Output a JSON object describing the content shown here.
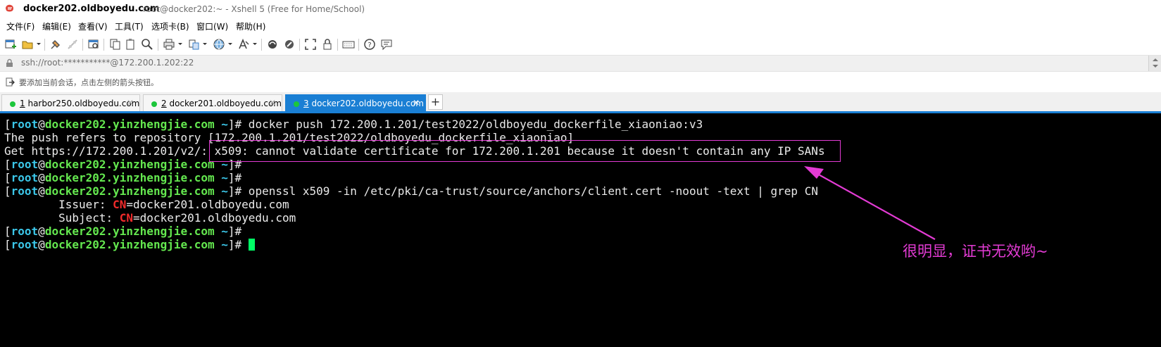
{
  "window": {
    "title_main": "docker202.oldboyedu.com",
    "title_sub": "root@docker202:~ - Xshell 5 (Free for Home/School)"
  },
  "menu": {
    "items": [
      "文件(F)",
      "编辑(E)",
      "查看(V)",
      "工具(T)",
      "选项卡(B)",
      "窗口(W)",
      "帮助(H)"
    ]
  },
  "toolbar": {
    "icons": [
      "new-session-icon",
      "open-folder-icon",
      "connect-icon",
      "disconnect-icon",
      "properties-icon",
      "copy-icon",
      "paste-icon",
      "find-icon",
      "print-icon",
      "transfer-icon",
      "globe-icon",
      "font-icon",
      "xftp-icon",
      "xmanager-icon",
      "fullscreen-icon",
      "lock-icon",
      "keyboard-icon",
      "help-icon",
      "chat-icon"
    ]
  },
  "address": {
    "text": "ssh://root:***********@172.200.1.202:22"
  },
  "hint": {
    "text": "要添加当前会话，点击左侧的箭头按钮。"
  },
  "tabs": [
    {
      "num": "1",
      "label": "harbor250.oldboyedu.com",
      "active": false
    },
    {
      "num": "2",
      "label": "docker201.oldboyedu.com",
      "active": false
    },
    {
      "num": "3",
      "label": "docker202.oldboyedu.com",
      "active": true
    }
  ],
  "terminal": {
    "prompt": {
      "open": "[",
      "user": "root",
      "at": "@",
      "host": "docker202.yinzhengjie.com",
      "path": " ~",
      "close": "]#"
    },
    "lines": [
      {
        "kind": "prompt",
        "cmd": " docker push 172.200.1.201/test2022/oldboyedu_dockerfile_xiaoniao:v3"
      },
      {
        "kind": "text",
        "text": "The push refers to repository [172.200.1.201/test2022/oldboyedu_dockerfile_xiaoniao]"
      },
      {
        "kind": "text",
        "text": "Get https://172.200.1.201/v2/: x509: cannot validate certificate for 172.200.1.201 because it doesn't contain any IP SANs"
      },
      {
        "kind": "prompt",
        "cmd": ""
      },
      {
        "kind": "prompt",
        "cmd": ""
      },
      {
        "kind": "prompt",
        "cmd": " openssl x509 -in /etc/pki/ca-trust/source/anchors/client.cert -noout -text | grep CN"
      },
      {
        "kind": "cn",
        "prefix": "        Issuer: ",
        "cn": "CN",
        "rest": "=docker201.oldboyedu.com"
      },
      {
        "kind": "cn",
        "prefix": "        Subject: ",
        "cn": "CN",
        "rest": "=docker201.oldboyedu.com"
      },
      {
        "kind": "prompt",
        "cmd": ""
      },
      {
        "kind": "prompt",
        "cmd": " ",
        "cursor": true
      }
    ]
  },
  "annotation": {
    "text": "很明显，证书无效哟~",
    "color": "#e33bd4"
  },
  "colors": {
    "tab_active": "#1a7fd4",
    "prompt_user": "#3bc6e8",
    "prompt_host": "#64e84f",
    "cn_highlight": "#f02b2b",
    "cursor": "#00ff66"
  }
}
